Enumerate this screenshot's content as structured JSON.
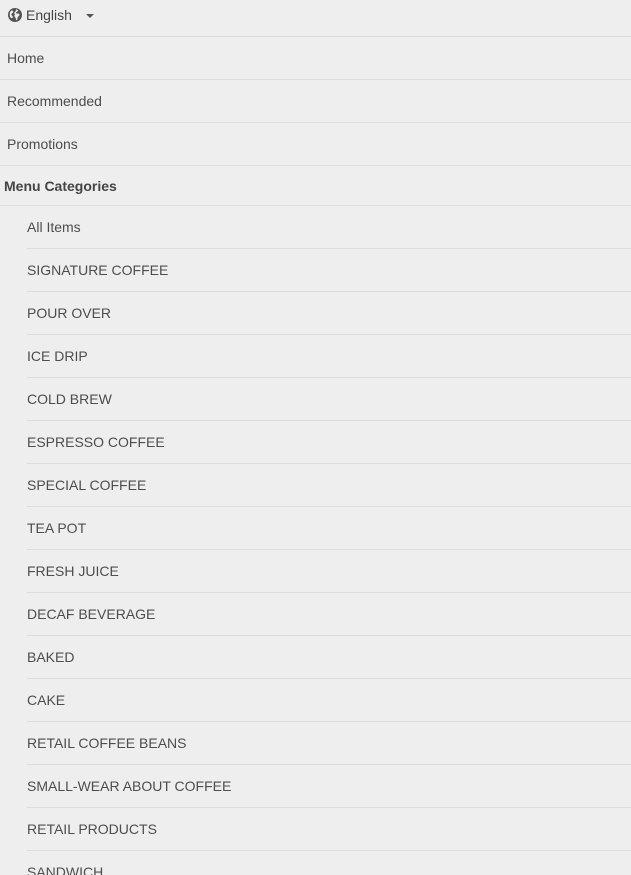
{
  "language": {
    "icon": "globe-icon",
    "label": "English",
    "dropdown_icon": "caret-down-icon"
  },
  "nav": {
    "items": [
      {
        "label": "Home"
      },
      {
        "label": "Recommended"
      },
      {
        "label": "Promotions"
      }
    ]
  },
  "categories": {
    "header": "Menu Categories",
    "items": [
      {
        "label": "All Items"
      },
      {
        "label": "SIGNATURE COFFEE"
      },
      {
        "label": "POUR OVER"
      },
      {
        "label": "ICE DRIP"
      },
      {
        "label": "COLD BREW"
      },
      {
        "label": "ESPRESSO COFFEE"
      },
      {
        "label": "SPECIAL COFFEE"
      },
      {
        "label": "TEA POT"
      },
      {
        "label": "FRESH JUICE"
      },
      {
        "label": "DECAF BEVERAGE"
      },
      {
        "label": "BAKED"
      },
      {
        "label": "CAKE"
      },
      {
        "label": "RETAIL COFFEE BEANS"
      },
      {
        "label": "SMALL-WEAR ABOUT COFFEE"
      },
      {
        "label": "RETAIL PRODUCTS"
      },
      {
        "label": "SANDWICH"
      }
    ]
  },
  "colors": {
    "background": "#eeeeee",
    "divider": "#dcdcdc",
    "text": "#4d4d4d"
  }
}
